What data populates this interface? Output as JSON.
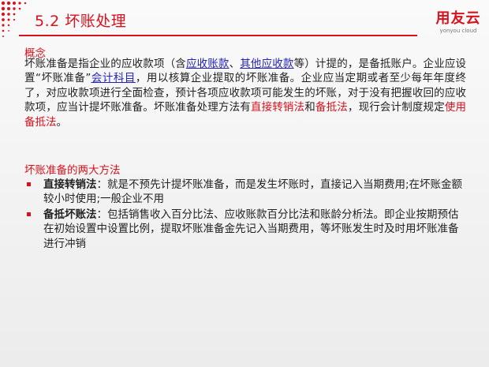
{
  "header": {
    "title": "5.2  坏账处理",
    "logo_cn": "用友云",
    "logo_en": "yonyou cloud"
  },
  "section1": {
    "heading": "概念",
    "paragraph": [
      {
        "text": "坏账准备是指企业的应收款项（含",
        "style": "plain"
      },
      {
        "text": "应收账款",
        "style": "link"
      },
      {
        "text": "、",
        "style": "plain"
      },
      {
        "text": "其他应收款",
        "style": "link"
      },
      {
        "text": "等）计提的，是备抵账户。企业应设置“坏账准备”",
        "style": "plain"
      },
      {
        "text": "会计科目",
        "style": "link"
      },
      {
        "text": "，用以核算企业提取的坏账准备。企业应当定期或者至少每年年度终了，对应收款项进行全面检查，预计各项应收款项可能发生的坏账，对于没有把握收回的应收款项，应当计提坏账准备。坏账准备处理方法有",
        "style": "plain"
      },
      {
        "text": "直接转销法",
        "style": "red"
      },
      {
        "text": "和",
        "style": "plain"
      },
      {
        "text": "备抵法",
        "style": "red"
      },
      {
        "text": "，现行会计制度规定",
        "style": "plain"
      },
      {
        "text": "使用备抵法",
        "style": "red"
      },
      {
        "text": "。",
        "style": "plain"
      }
    ]
  },
  "section2": {
    "heading": "坏账准备的两大方法",
    "bullets": [
      {
        "term": "直接转销法",
        "desc": "：就是不预先计提坏账准备，而是发生坏账时，直接记入当期费用;在坏账金额较小时使用;一般企业不用"
      },
      {
        "term": "备抵坏账法",
        "desc": "：包括销售收入百分比法、应收账款百分比法和账龄分析法。即企业按期预估在初始设置中设置比例，提取坏账准备金先记入当期费用，等坏账发生时及时用坏账准备进行冲销"
      }
    ]
  },
  "colors": {
    "accent": "#d8121d",
    "link": "#2323b8",
    "text": "#222222"
  }
}
